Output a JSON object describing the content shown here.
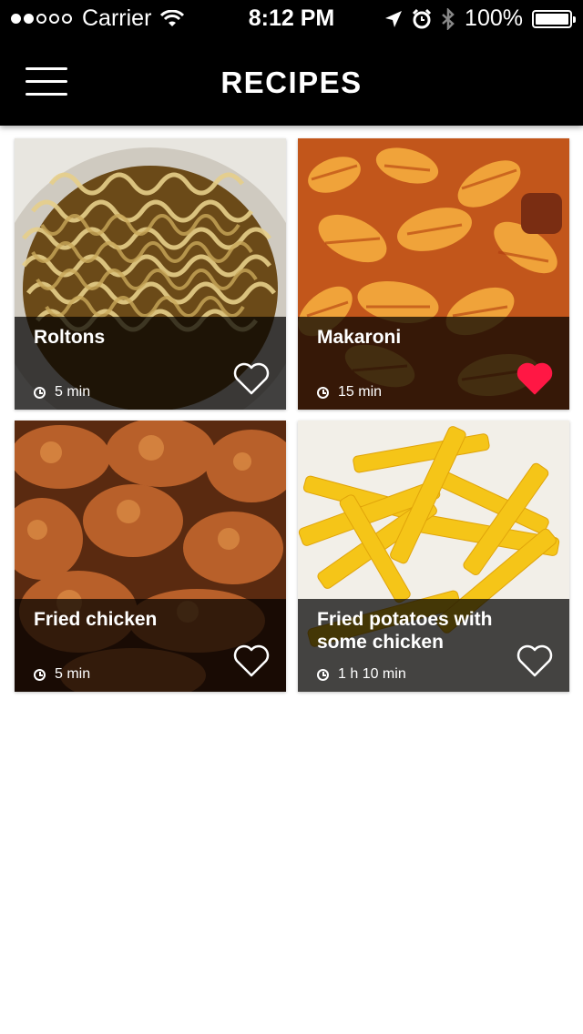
{
  "status_bar": {
    "carrier": "Carrier",
    "time": "8:12 PM",
    "battery": "100%",
    "signal_icon": "signal-dots-icon",
    "wifi_icon": "wifi-icon",
    "location_icon": "location-arrow-icon",
    "alarm_icon": "alarm-icon",
    "bluetooth_icon": "bluetooth-icon",
    "battery_icon": "battery-icon"
  },
  "header": {
    "title": "RECIPES",
    "menu_icon": "hamburger-menu-icon"
  },
  "colors": {
    "header_bg": "#000000",
    "favorite_active": "#ff1744",
    "text": "#ffffff"
  },
  "recipes": [
    {
      "title": "Roltons",
      "time": "5 min",
      "favorite": false,
      "icon": "heart-outline-icon"
    },
    {
      "title": "Makaroni",
      "time": "15 min",
      "favorite": true,
      "icon": "heart-filled-icon"
    },
    {
      "title": "Fried chicken",
      "time": "5 min",
      "favorite": false,
      "icon": "heart-outline-icon"
    },
    {
      "title": "Fried potatoes with some chicken",
      "time": "1 h 10 min",
      "favorite": false,
      "icon": "heart-outline-icon"
    }
  ]
}
